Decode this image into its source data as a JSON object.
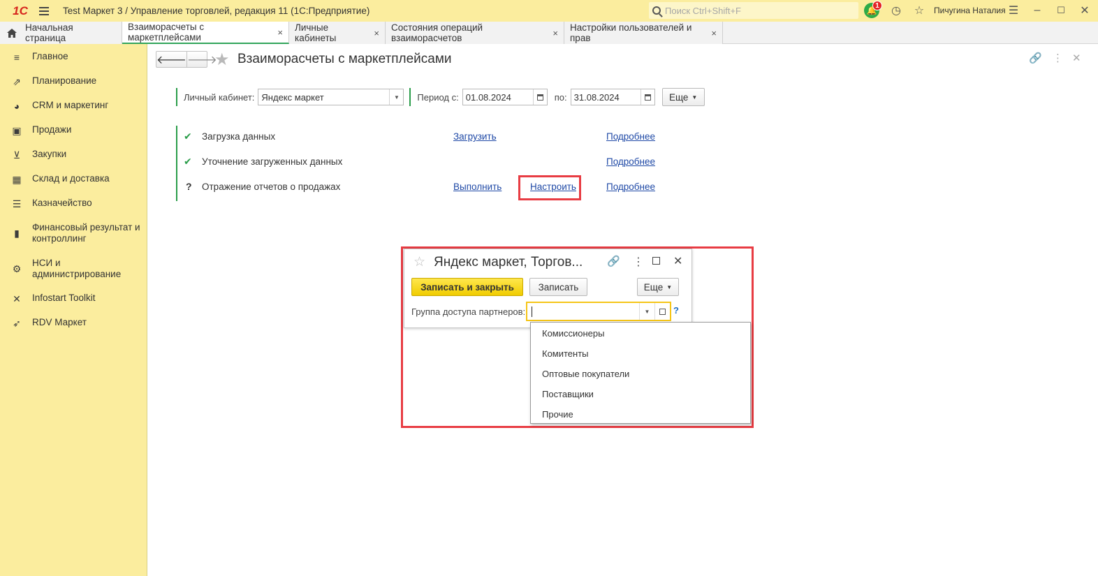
{
  "titlebar": {
    "logo": "1С",
    "title": "Test Маркет 3 / Управление торговлей, редакция 11  (1С:Предприятие)",
    "search_placeholder": "Поиск Ctrl+Shift+F",
    "notification_count": "1",
    "user": "Пичугина Наталия"
  },
  "tabs": [
    {
      "label": "Начальная страница"
    },
    {
      "label": "Взаиморасчеты с маркетплейсами",
      "close": "×"
    },
    {
      "label": "Личные кабинеты",
      "close": "×"
    },
    {
      "label": "Состояния операций взаиморасчетов",
      "close": "×"
    },
    {
      "label": "Настройки пользователей и прав",
      "close": "×"
    }
  ],
  "sidebar": {
    "items": [
      {
        "label": "Главное",
        "icon": "menu-lines-icon"
      },
      {
        "label": "Планирование",
        "icon": "planning-chart-icon"
      },
      {
        "label": "CRM и маркетинг",
        "icon": "pie-chart-icon"
      },
      {
        "label": "Продажи",
        "icon": "shopping-bag-icon"
      },
      {
        "label": "Закупки",
        "icon": "cart-icon"
      },
      {
        "label": "Склад и доставка",
        "icon": "warehouse-grid-icon"
      },
      {
        "label": "Казначейство",
        "icon": "coins-icon"
      },
      {
        "label": "Финансовый результат и контроллинг",
        "icon": "bar-chart-icon"
      },
      {
        "label": "НСИ и администрирование",
        "icon": "gear-icon"
      },
      {
        "label": "Infostart Toolkit",
        "icon": "tools-icon"
      },
      {
        "label": "RDV Маркет",
        "icon": "rocket-icon"
      }
    ]
  },
  "page": {
    "title": "Взаиморасчеты с маркетплейсами",
    "account_label": "Личный кабинет:",
    "account_value": "Яндекс маркет",
    "period_from_label": "Период с:",
    "period_from": "01.08.2024",
    "period_to_label": "по:",
    "period_to": "31.08.2024",
    "more_label": "Еще",
    "steps": [
      {
        "status": "✔",
        "label": "Загрузка данных",
        "action": "Загрузить",
        "details": "Подробнее"
      },
      {
        "status": "✔",
        "label": "Уточнение загруженных данных",
        "action": "",
        "details": "Подробнее"
      },
      {
        "status": "?",
        "label": "Отражение отчетов о продажах",
        "action": "Выполнить",
        "setup": "Настроить",
        "details": "Подробнее"
      }
    ]
  },
  "popup": {
    "title": "Яндекс маркет, Торгов...",
    "save_close": "Записать и закрыть",
    "save": "Записать",
    "more": "Еще",
    "field_label": "Группа доступа партнеров:",
    "field_value": "",
    "help": "?",
    "options": [
      "Комиссионеры",
      "Комитенты",
      "Оптовые покупатели",
      "Поставщики",
      "Прочие"
    ]
  },
  "colors": {
    "sidebar_bg": "#fbed9e",
    "accent_green": "#2a9d4a",
    "link": "#1f49a6",
    "highlight": "#e83c43",
    "primary_button": "#f5d20f"
  }
}
